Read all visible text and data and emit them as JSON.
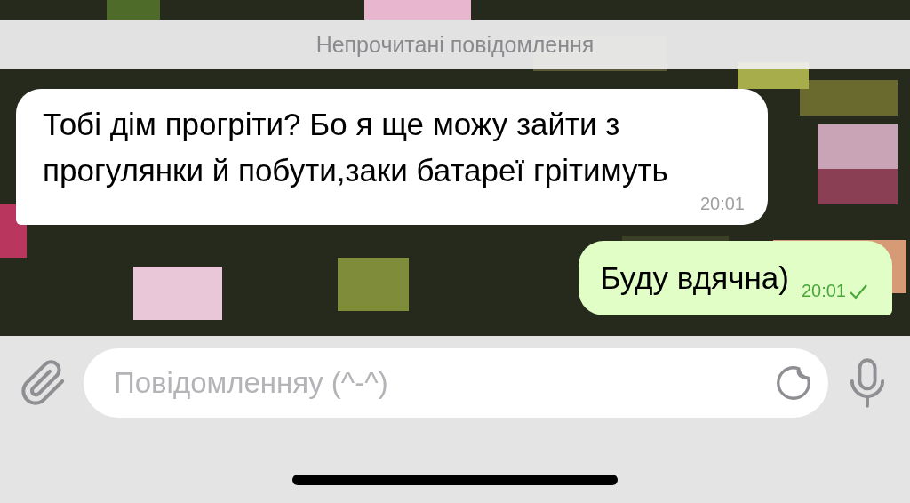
{
  "unread_banner": "Непрочитані повідомлення",
  "messages": [
    {
      "kind": "incoming",
      "text": "Тобі дім прогріти? Бо я ще можу зайти з прогулянки й побути,заки батареї грітимуть",
      "time": "20:01"
    },
    {
      "kind": "outgoing",
      "text": "Буду вдячна)",
      "time": "20:01",
      "sent": true
    }
  ],
  "composer": {
    "placeholder": "Повідомленняу (^-^)"
  }
}
